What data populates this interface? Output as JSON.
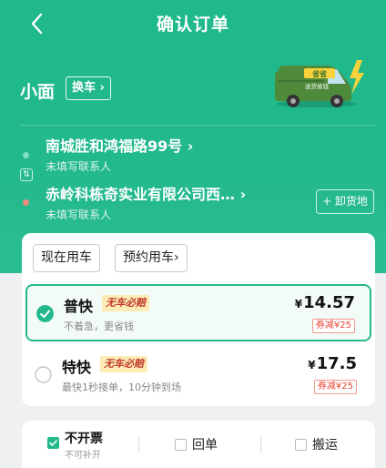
{
  "header": {
    "title": "确认订单",
    "vehicle_name": "小面",
    "switch_label": "换车",
    "promo_badge": "省省",
    "promo_slogan": "送货省钱"
  },
  "addresses": [
    {
      "title": "南城胜和鸿福路99号",
      "contact": "未填写联系人",
      "dot_color": "#7fe0bd"
    },
    {
      "title": "赤岭科栋奇实业有限公司西…",
      "contact": "未填写联系人",
      "dot_color": "#f08a7a"
    }
  ],
  "swap_label": "⇅",
  "unload_label": "+ 卸货地",
  "time_tabs": [
    "现在用车",
    "预约用车"
  ],
  "options": [
    {
      "name": "普快",
      "tag": "无车必赔",
      "desc": "不着急，更省钱",
      "currency": "¥",
      "price": "14.57",
      "coupon": "券减¥25",
      "selected": true
    },
    {
      "name": "特快",
      "tag": "无车必赔",
      "desc": "最快1秒接单，10分钟到场",
      "currency": "¥",
      "price": "17.5",
      "coupon": "券减¥25",
      "selected": false
    }
  ],
  "bottom": {
    "invoice_label": "不开票",
    "invoice_note": "不可补开",
    "receipt_label": "回单",
    "carry_label": "搬运"
  },
  "colors": {
    "brand": "#22b98c",
    "price_red": "#e8432e",
    "tag_bg": "#fdebb6"
  }
}
